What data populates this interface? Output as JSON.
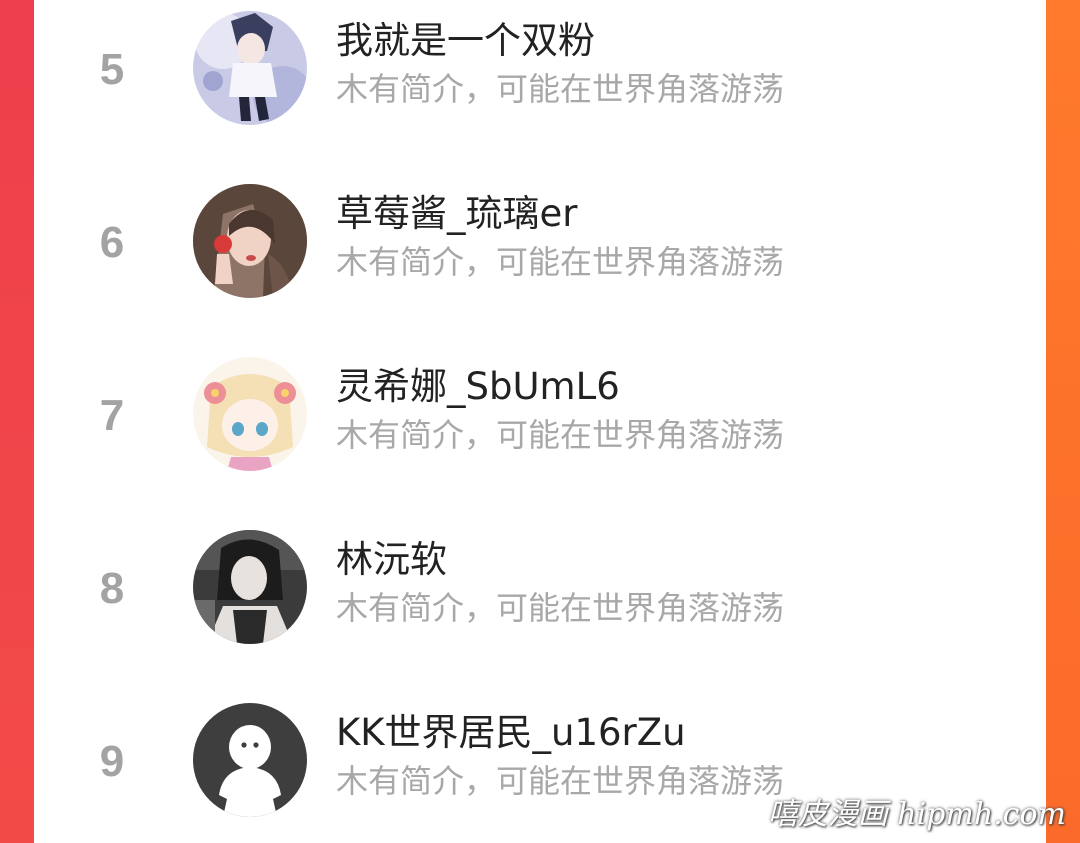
{
  "ranking": {
    "items": [
      {
        "rank": "5",
        "name": "我就是一个双粉",
        "intro": "木有简介，可能在世界角落游荡",
        "avatar_icon": "anime-boy-avatar"
      },
      {
        "rank": "6",
        "name": "草莓酱_琉璃er",
        "intro": "木有简介，可能在世界角落游荡",
        "avatar_icon": "strawberry-girl-avatar"
      },
      {
        "rank": "7",
        "name": "灵希娜_SbUmL6",
        "intro": "木有简介，可能在世界角落游荡",
        "avatar_icon": "flower-chibi-avatar"
      },
      {
        "rank": "8",
        "name": "林沅软",
        "intro": "木有简介，可能在世界角落游荡",
        "avatar_icon": "photo-girl-avatar"
      },
      {
        "rank": "9",
        "name": "KK世界居民_u16rZu",
        "intro": "木有简介，可能在世界角落游荡",
        "avatar_icon": "default-user-avatar"
      }
    ]
  },
  "watermark": "嘻皮漫画 hipmh.com",
  "colors": {
    "left_edge": "#f2424a",
    "right_edge": "#fb6e2c",
    "rank_text": "#a3a3a3",
    "name_text": "#222222",
    "intro_text": "#a8a8a8"
  }
}
